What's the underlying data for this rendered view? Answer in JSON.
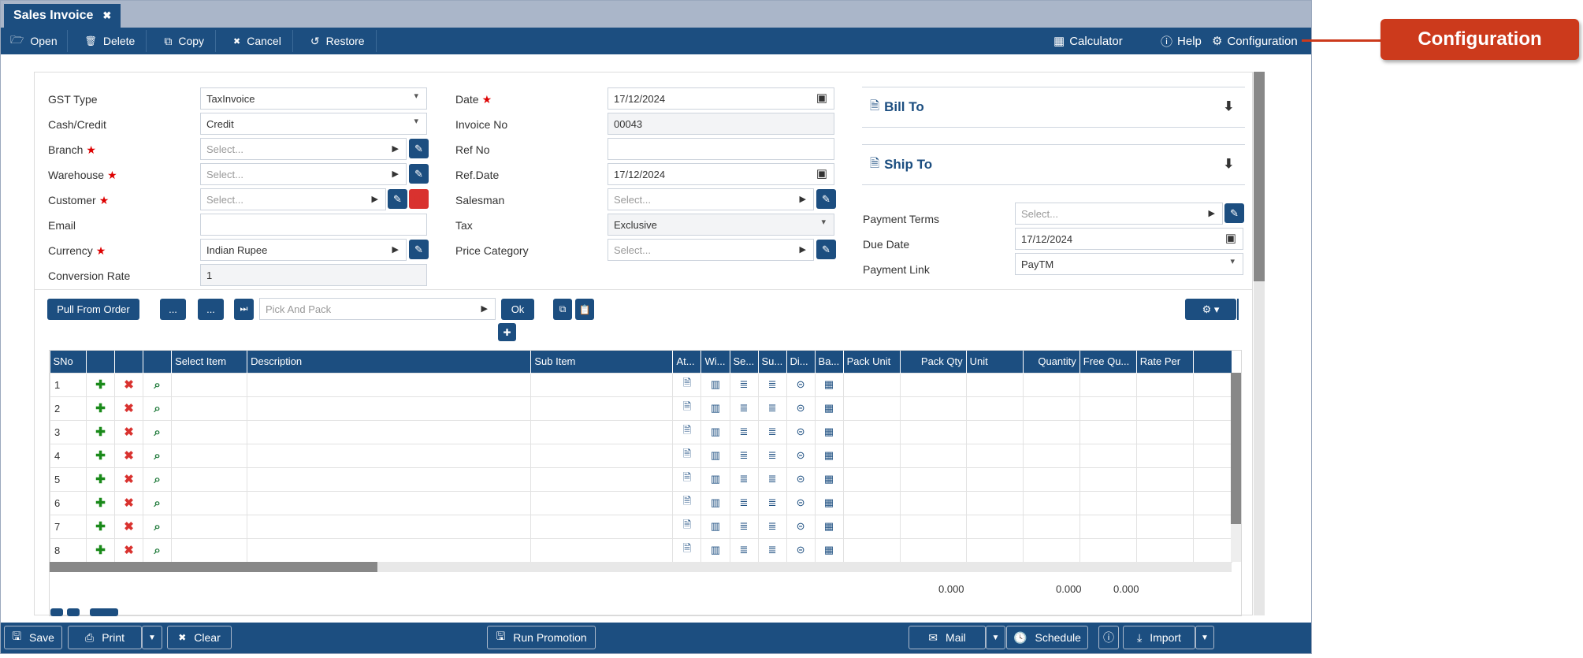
{
  "tab": {
    "title": "Sales Invoice",
    "close": "✖"
  },
  "toolbar": {
    "buttons": [
      {
        "icon": "folder-open-icon",
        "glyph": "🗁",
        "label": "Open"
      },
      {
        "icon": "trash-icon",
        "glyph": "🗑",
        "label": "Delete"
      },
      {
        "icon": "copy-icon",
        "glyph": "⧉",
        "label": "Copy"
      },
      {
        "icon": "close-icon",
        "glyph": "✖",
        "label": "Cancel"
      },
      {
        "icon": "restore-icon",
        "glyph": "↺",
        "label": "Restore"
      }
    ],
    "calculator": "Calculator",
    "help": "Help",
    "configuration": "Configuration"
  },
  "form": {
    "gst_type": {
      "label": "GST Type",
      "value": "TaxInvoice"
    },
    "cash_credit": {
      "label": "Cash/Credit",
      "value": "Credit"
    },
    "branch": {
      "label": "Branch",
      "placeholder": "Select..."
    },
    "warehouse": {
      "label": "Warehouse",
      "placeholder": "Select..."
    },
    "customer": {
      "label": "Customer",
      "placeholder": "Select..."
    },
    "email": {
      "label": "Email",
      "value": ""
    },
    "currency": {
      "label": "Currency",
      "value": "Indian Rupee"
    },
    "conversion_rate": {
      "label": "Conversion Rate",
      "value": "1"
    },
    "date": {
      "label": "Date",
      "value": "17/12/2024"
    },
    "invoice_no": {
      "label": "Invoice No",
      "value": "00043"
    },
    "ref_no": {
      "label": "Ref No",
      "value": ""
    },
    "ref_date": {
      "label": "Ref.Date",
      "value": "17/12/2024"
    },
    "salesman": {
      "label": "Salesman",
      "placeholder": "Select..."
    },
    "tax": {
      "label": "Tax",
      "value": "Exclusive"
    },
    "price_category": {
      "label": "Price Category",
      "placeholder": "Select..."
    },
    "bill_to": "Bill To",
    "ship_to": "Ship To",
    "payment_terms": {
      "label": "Payment Terms",
      "placeholder": "Select..."
    },
    "due_date": {
      "label": "Due Date",
      "value": "17/12/2024"
    },
    "payment_link": {
      "label": "Payment Link",
      "value": "PayTM"
    }
  },
  "actions": {
    "pull_from_order": "Pull From Order",
    "dots1": "...",
    "dots2": "...",
    "pick_and_pack_placeholder": "Pick And Pack",
    "ok": "Ok"
  },
  "grid": {
    "columns": [
      "SNo",
      "",
      "",
      "",
      "Select Item",
      "Description",
      "Sub Item",
      "At...",
      "Wi...",
      "Se...",
      "Su...",
      "Di...",
      "Ba...",
      "Pack Unit",
      "Pack Qty",
      "Unit",
      "Quantity",
      "Free Qu...",
      "Rate Per",
      ""
    ],
    "rows": [
      "1",
      "2",
      "3",
      "4",
      "5",
      "6",
      "7",
      "8"
    ],
    "totals": {
      "pack_qty": "0.000",
      "quantity": "0.000",
      "free_qty": "0.000"
    }
  },
  "footer": {
    "save": "Save",
    "print": "Print",
    "clear": "Clear",
    "run_promotion": "Run Promotion",
    "mail": "Mail",
    "schedule": "Schedule",
    "import": "Import"
  },
  "callout": "Configuration",
  "colors": {
    "primary": "#1c4e80",
    "callout": "#cc3a1c",
    "danger": "#d9322f"
  }
}
